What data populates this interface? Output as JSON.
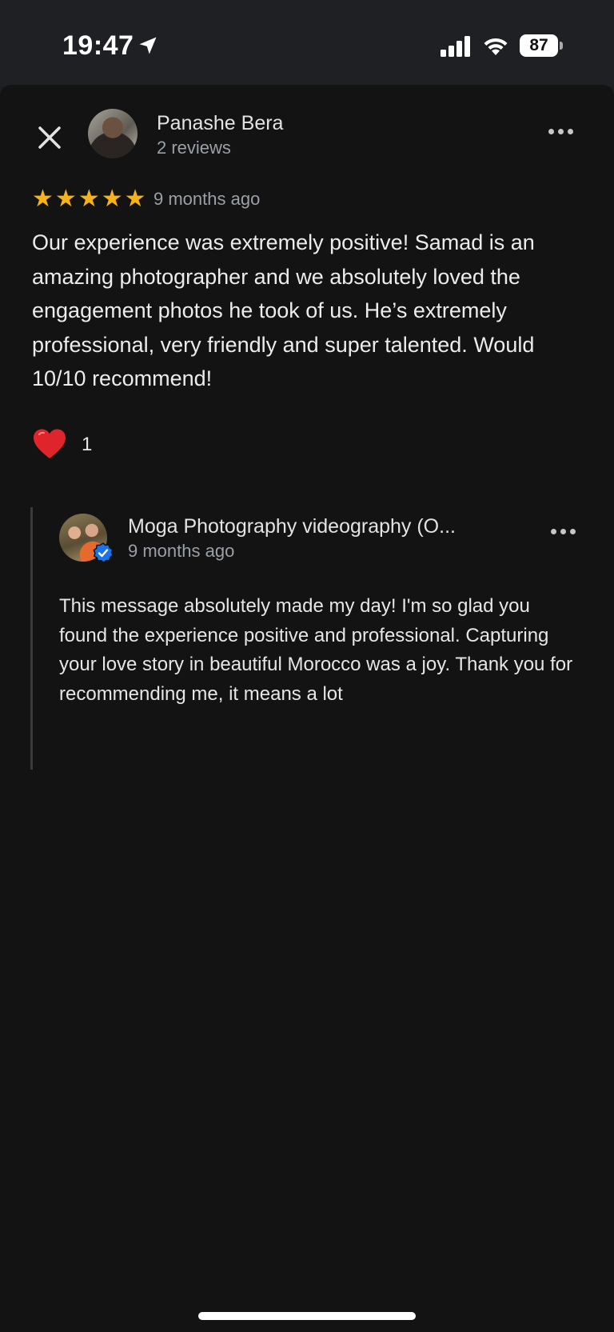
{
  "status_bar": {
    "time": "19:47",
    "battery_level": "87",
    "icons": [
      "location-arrow-icon",
      "cellular-signal-icon",
      "wifi-icon",
      "battery-icon"
    ]
  },
  "review": {
    "reviewer_name": "Panashe Bera",
    "reviewer_meta": "2 reviews",
    "rating": 5,
    "rating_max": 5,
    "star_glyph": "★",
    "date": "9 months ago",
    "text": "Our experience was extremely positive! Samad is an amazing photographer and we absolutely loved the engagement photos he took of us. He’s extremely professional, very friendly and super talented. Would 10/10 recommend!",
    "reaction_count": "1"
  },
  "owner_reply": {
    "name": "Moga Photography videography (O...",
    "date": "9 months ago",
    "text": "This message absolutely made my day! I'm so glad you found the experience positive and professional. Capturing your love story in beautiful Morocco was a joy. Thank you for recommending me, it means a lot",
    "verified": true
  },
  "colors": {
    "background": "#131314",
    "star": "#f6b21b",
    "heart": "#e0242c",
    "verified_badge": "#1a73e8",
    "secondary_text": "#9aa0a6"
  }
}
